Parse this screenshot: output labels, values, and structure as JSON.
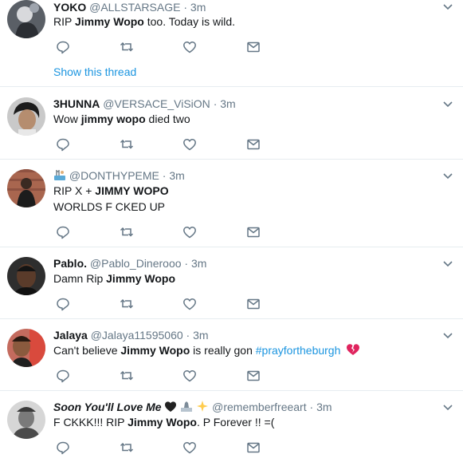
{
  "tweets": [
    {
      "name": "YOKO",
      "handle": "@ALLSTARSAGE",
      "sep": "·",
      "time": "3m",
      "text_parts": [
        "RIP ",
        "Jimmy Wopo",
        " too. Today is wild."
      ],
      "show_thread": "Show this thread"
    },
    {
      "name": "3HUNNA",
      "handle": "@VERSACE_ViSiON",
      "sep": "·",
      "time": "3m",
      "text_parts": [
        "Wow ",
        "jimmy wopo",
        " died two"
      ]
    },
    {
      "name": "",
      "handle": "@DONTHYPEME",
      "sep": "·",
      "time": "3m",
      "line1_parts": [
        "RIP X + ",
        "JIMMY WOPO"
      ],
      "line2": "WORLDS F   CKED UP"
    },
    {
      "name": "Pablo.",
      "handle": "@Pablo_Dinerooo",
      "sep": "·",
      "time": "3m",
      "text_parts": [
        "Damn Rip ",
        "Jimmy Wopo"
      ]
    },
    {
      "name": "Jalaya",
      "handle": "@Jalaya11595060",
      "sep": "·",
      "time": "3m",
      "text_parts": [
        "Can't believe ",
        "Jimmy Wopo",
        " is really gon "
      ],
      "hashtag": "#prayfortheburgh"
    },
    {
      "name": "Soon You'll Love Me",
      "handle": "@rememberfreeart",
      "sep": "·",
      "time": "3m",
      "text_parts": [
        "F   CKKK!!! RIP ",
        "Jimmy Wopo",
        ". P Forever !! =("
      ]
    }
  ],
  "colors": {
    "text": "#14171a",
    "muted": "#657786",
    "link": "#1b95e0",
    "divider": "#e6ecf0",
    "icon": "#657786"
  },
  "icons": [
    "reply-icon",
    "retweet-icon",
    "like-icon",
    "dm-icon",
    "chevron-down-icon"
  ]
}
